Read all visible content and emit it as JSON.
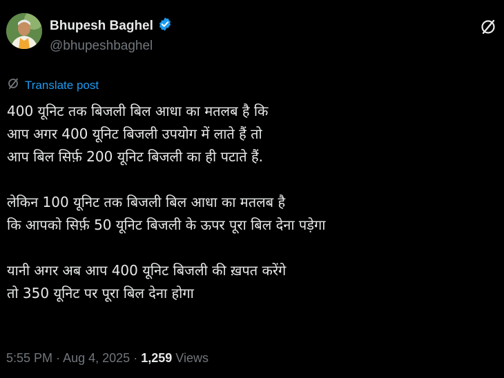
{
  "author": {
    "name": "Bhupesh Baghel",
    "handle": "@bhupeshbaghel"
  },
  "translate_label": "Translate post",
  "post": {
    "paragraphs": [
      {
        "lines": [
          "400 यूनिट तक बिजली बिल आधा का मतलब है कि",
          "आप अगर 400 यूनिट बिजली उपयोग में लाते हैं तो",
          "आप बिल सिर्फ़ 200 यूनिट बिजली का ही पटाते हैं."
        ]
      },
      {
        "lines": [
          "लेकिन 100 यूनिट तक बिजली बिल आधा का मतलब है",
          "कि आपको सिर्फ़ 50 यूनिट बिजली के ऊपर पूरा बिल देना पड़ेगा"
        ]
      },
      {
        "lines": [
          "यानी अगर अब आप 400 यूनिट बिजली की ख़पत करेंगे",
          "तो 350 यूनिट पर पूरा बिल देना होगा"
        ]
      }
    ]
  },
  "meta": {
    "time": "5:55 PM",
    "separator": "·",
    "date": "Aug 4, 2025",
    "views_count": "1,259",
    "views_label": "Views"
  },
  "colors": {
    "background": "#000000",
    "text": "#e7e9ea",
    "muted": "#71767b",
    "accent": "#1d9bf0"
  },
  "icons": {
    "verified": "verified-badge-icon",
    "grok": "grok-icon",
    "translate": "translate-icon"
  }
}
